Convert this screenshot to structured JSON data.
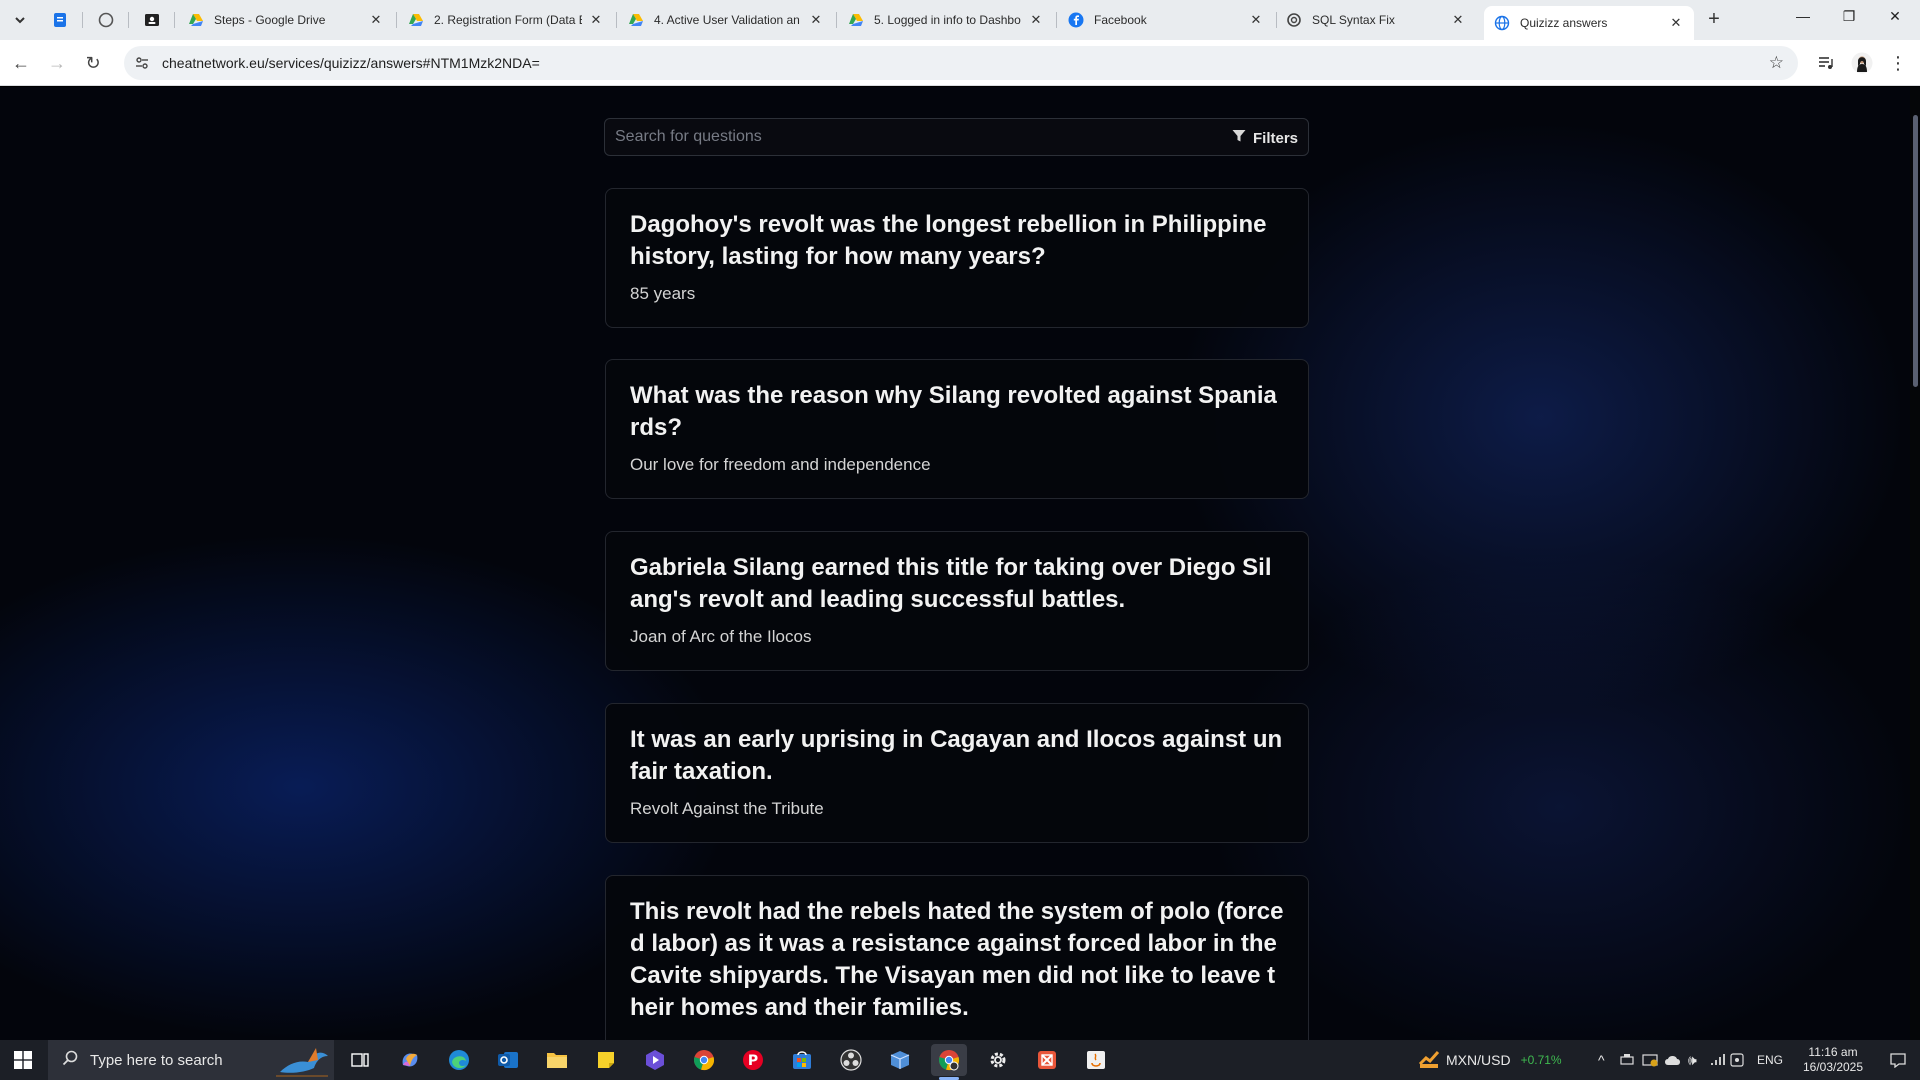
{
  "browser": {
    "tabs": [
      {
        "label": "",
        "icon": "google-keep-icon",
        "active": false
      },
      {
        "label": "",
        "icon": "github-icon",
        "active": false
      },
      {
        "label": "",
        "icon": "contact-card-icon",
        "active": false
      },
      {
        "label": "Steps - Google Drive",
        "icon": "google-drive-icon",
        "active": false
      },
      {
        "label": "2. Registration Form (Data E",
        "icon": "google-drive-icon",
        "active": false
      },
      {
        "label": "4. Active User Validation an",
        "icon": "google-drive-icon",
        "active": false
      },
      {
        "label": "5. Logged in info to Dashbo",
        "icon": "google-drive-icon",
        "active": false
      },
      {
        "label": "Facebook",
        "icon": "facebook-icon",
        "active": false
      },
      {
        "label": "SQL Syntax Fix",
        "icon": "openai-icon",
        "active": false
      },
      {
        "label": "Quizizz answers",
        "icon": "globe-icon",
        "active": true
      }
    ],
    "url": "cheatnetwork.eu/services/quizizz/answers#NTM1Mzk2NDA="
  },
  "page": {
    "search": {
      "placeholder": "Search for questions",
      "value": ""
    },
    "filters_label": "Filters",
    "cards": [
      {
        "question": "Dagohoy's revolt was the longest rebellion in Philippine history, lasting for how many years?",
        "answer": "85 years"
      },
      {
        "question": "What was the reason why Silang revolted against Spaniards?",
        "answer": "Our love for freedom and independence"
      },
      {
        "question": "Gabriela Silang earned this title for taking over Diego Silang's revolt and leading successful battles.",
        "answer": "Joan of Arc of the Ilocos"
      },
      {
        "question": "It was an early uprising in Cagayan and Ilocos against unfair taxation.",
        "answer": "Revolt Against the Tribute"
      },
      {
        "question": "This revolt had the rebels hated the system of polo (forced labor) as it was a resistance against forced labor in the Cavite shipyards. The Visayan men did not like to leave their homes and their families.",
        "answer": ""
      }
    ]
  },
  "taskbar": {
    "search_placeholder": "Type here to search",
    "apps": [
      "task-view-icon",
      "copilot-icon",
      "edge-icon",
      "outlook-icon",
      "file-explorer-icon",
      "sticky-notes-icon",
      "media-player-icon",
      "chrome-icon",
      "pinterest-icon",
      "store-icon",
      "obs-icon",
      "box-icon",
      "chrome-profile-icon",
      "settings-icon",
      "app-icon",
      "java-icon"
    ],
    "ticker": {
      "label": "MXN/USD",
      "change": "+0.71%"
    },
    "language": "ENG",
    "time": "11:16 am",
    "date": "16/03/2025"
  },
  "colors": {
    "ticker_up": "#3fb950",
    "accent": "#8ab4f8"
  }
}
